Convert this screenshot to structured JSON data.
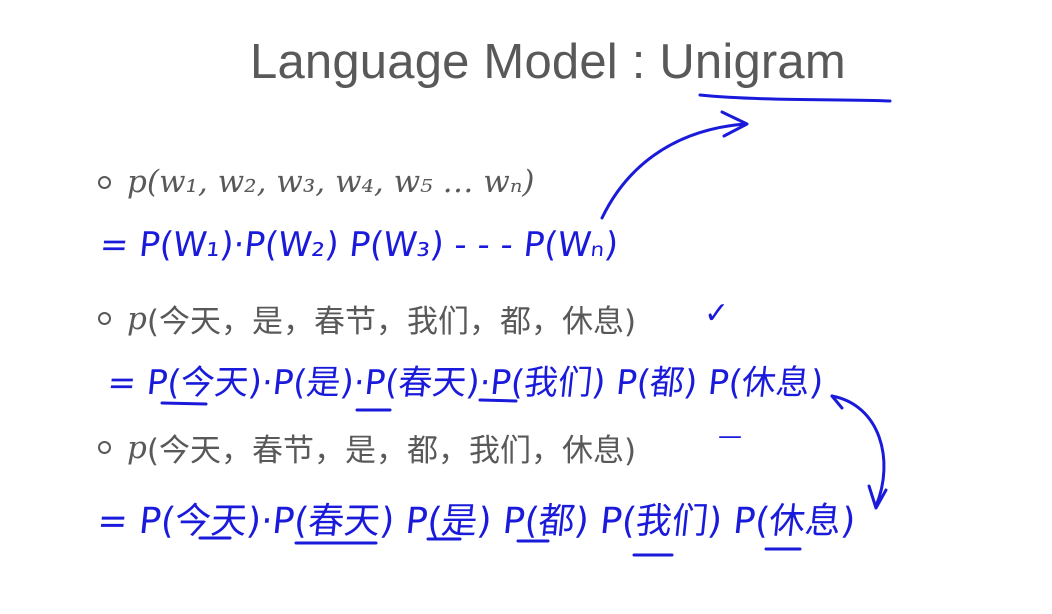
{
  "slide": {
    "title": "Language Model : Unigram",
    "bullets": [
      {
        "math_prefix": "p(",
        "content": "w₁, w₂, w₃, w₄, w₅ … wₙ)",
        "math_suffix": ""
      },
      {
        "math_prefix": "p",
        "content": "(今天，是，春节，我们，都，休息)",
        "math_suffix": ""
      },
      {
        "math_prefix": "p",
        "content": "(今天，春节，是，都，我们，休息)",
        "math_suffix": ""
      }
    ],
    "handwriting": {
      "line1": "= P(W₁)·P(W₂) P(W₃) - - -   P(Wₙ)",
      "line2": "= P(今天)·P(是)·P(春天)·P(我们) P(都)  P(休息)",
      "line3": "= P(今天)·P(春天) P(是) P(都) P(我们)  P(休息)",
      "check_mark": "✓",
      "dash_mark": "—"
    }
  },
  "colors": {
    "title_text": "#595959",
    "body_text": "#595959",
    "ink": "#1a1adb",
    "background": "#ffffff"
  }
}
